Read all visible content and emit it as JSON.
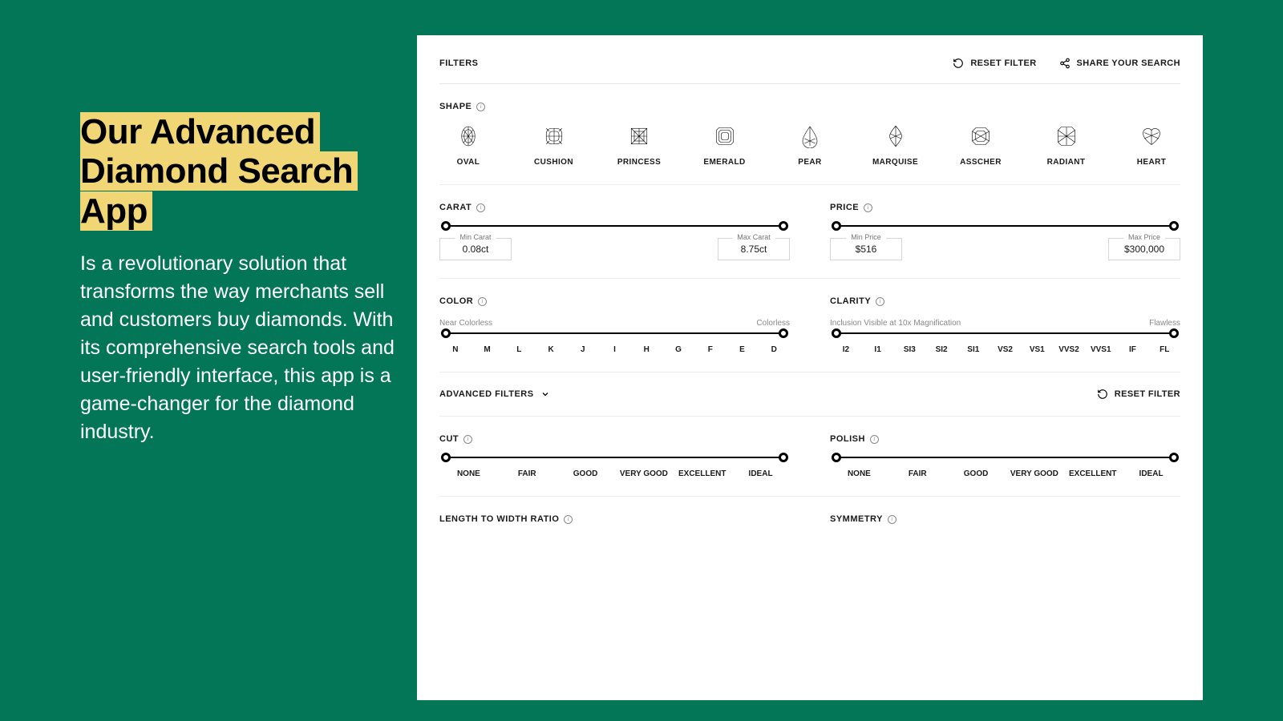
{
  "marketing": {
    "headline_l1": "Our Advanced",
    "headline_l2": "Diamond Search App",
    "body": "Is a revolutionary solution that transforms the way merchants sell and customers buy diamonds. With its comprehensive search tools and user-friendly interface, this app is a game-changer for the diamond industry."
  },
  "topbar": {
    "filters_title": "FILTERS",
    "reset": "RESET FILTER",
    "share": "SHARE YOUR SEARCH"
  },
  "shape": {
    "label": "SHAPE",
    "items": [
      "OVAL",
      "CUSHION",
      "PRINCESS",
      "EMERALD",
      "PEAR",
      "MARQUISE",
      "ASSCHER",
      "RADIANT",
      "HEART"
    ]
  },
  "carat": {
    "label": "CARAT",
    "min_label": "Min Carat",
    "min_value": "0.08ct",
    "max_label": "Max Carat",
    "max_value": "8.75ct"
  },
  "price": {
    "label": "PRICE",
    "min_label": "Min Price",
    "min_value": "$516",
    "max_label": "Max Price",
    "max_value": "$300,000"
  },
  "color": {
    "label": "COLOR",
    "left_sub": "Near Colorless",
    "right_sub": "Colorless",
    "scale": [
      "N",
      "M",
      "L",
      "K",
      "J",
      "I",
      "H",
      "G",
      "F",
      "E",
      "D"
    ]
  },
  "clarity": {
    "label": "CLARITY",
    "left_sub": "Inclusion Visible at 10x Magnification",
    "right_sub": "Flawless",
    "scale": [
      "I2",
      "I1",
      "SI3",
      "SI2",
      "SI1",
      "VS2",
      "VS1",
      "VVS2",
      "VVS1",
      "IF",
      "FL"
    ]
  },
  "advanced": {
    "label": "ADVANCED FILTERS",
    "reset": "RESET FILTER"
  },
  "cut": {
    "label": "CUT",
    "scale": [
      "NONE",
      "FAIR",
      "GOOD",
      "VERY GOOD",
      "EXCELLENT",
      "IDEAL"
    ]
  },
  "polish": {
    "label": "POLISH",
    "scale": [
      "NONE",
      "FAIR",
      "GOOD",
      "VERY GOOD",
      "EXCELLENT",
      "IDEAL"
    ]
  },
  "ratio": {
    "label": "LENGTH TO WIDTH RATIO"
  },
  "symmetry": {
    "label": "SYMMETRY"
  }
}
